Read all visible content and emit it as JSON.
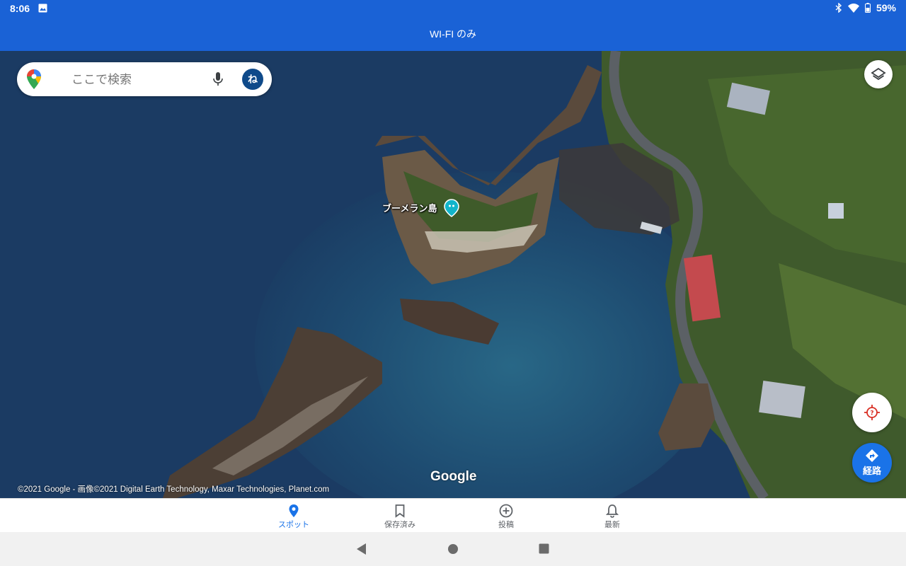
{
  "status_bar": {
    "time": "8:06",
    "battery": "59%"
  },
  "header": {
    "title": "WI-FI のみ"
  },
  "search": {
    "placeholder": "ここで検索",
    "avatar_initial": "ね"
  },
  "map": {
    "place_label": "ブーメラン島",
    "attribution": "©2021 Google - 画像©2021 Digital Earth Technology, Maxar Technologies, Planet.com",
    "logo": "Google",
    "route_label": "経路"
  },
  "bottom_nav": {
    "items": [
      {
        "label": "スポット",
        "icon": "location-pin-icon",
        "active": true
      },
      {
        "label": "保存済み",
        "icon": "bookmark-icon",
        "active": false
      },
      {
        "label": "投稿",
        "icon": "add-circle-icon",
        "active": false
      },
      {
        "label": "最新",
        "icon": "bell-icon",
        "active": false
      }
    ]
  },
  "colors": {
    "accent": "#1a73e8",
    "status_bar": "#1a62d6",
    "water": "#1c3f66",
    "pin": "#12b5cb"
  }
}
